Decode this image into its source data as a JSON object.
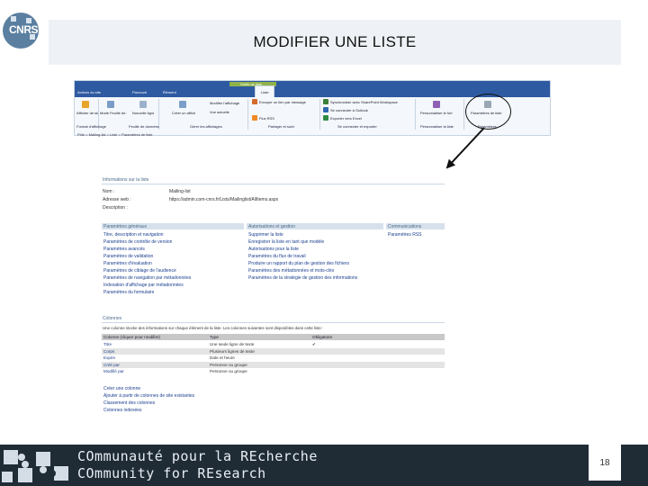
{
  "logo": {
    "text": "CNRS"
  },
  "slide": {
    "title": "MODIFIER UNE LISTE",
    "number": "18"
  },
  "ribbon": {
    "context_tab": "Outils de liste",
    "tabs": [
      "Parcourir",
      "Élément",
      "Liste"
    ],
    "top_left": "Actions du site",
    "buttons": [
      "Afficher de standard",
      "Mode Feuille de données",
      "Nouvelle ligne",
      "Créer un affichage",
      "Modifier l'affichage",
      "Vue actuelle",
      "Envoyer un lien par message",
      "Flux RSS",
      "Synchroniser avec SharePoint Workspace",
      "Se connecter à Outlook",
      "Exporter vers Excel",
      "Personnaliser le formulaire",
      "Paramètres de liste"
    ],
    "groups": [
      "Format d'affichage",
      "Feuille de données",
      "Gérer les affichages",
      "Partager et suivi",
      "Se connecter et exporter",
      "Personnaliser la liste",
      "Paramètres"
    ],
    "breadcrumb": "Pôle > Mailing-list > Liste > Paramètres de liste"
  },
  "panel": {
    "section_title": "Informations sur la liste",
    "name_label": "Nom :",
    "name_value": "Mailing-list",
    "address_label": "Adresse web :",
    "address_value": "https://admin.com-cnrs.fr/Lists/Mailinglist/AllItems.aspx",
    "desc_label": "Description :",
    "col_general": "Paramètres généraux",
    "col_perms": "Autorisations et gestion",
    "col_comm": "Communications",
    "general_links": [
      "Titre, description et navigation",
      "Paramètres de contrôle de version",
      "Paramètres avancés",
      "Paramètres de validation",
      "Paramètres d'évaluation",
      "Paramètres de ciblage de l'audience",
      "Paramètres de navigation par métadonnées",
      "Indexation d'affichage par métadonnées",
      "Paramètres du formulaire"
    ],
    "perm_links": [
      "Supprimer la liste",
      "Enregistrer la liste en tant que modèle",
      "Autorisations pour la liste",
      "Paramètres du flux de travail",
      "Produire un rapport du plan de gestion des fichiers",
      "Paramètres des métadonnées et mots-clés",
      "Paramètres de la stratégie de gestion des informations"
    ],
    "comm_links": [
      "Paramètres RSS"
    ],
    "columns_title": "Colonnes",
    "columns_desc": "Une colonne stocke des informations sur chaque élément de la liste. Les colonnes suivantes sont disponibles dans cette liste :",
    "table_headers": [
      "Colonne (cliquer pour modifier)",
      "Type",
      "Obligatoire"
    ],
    "table_rows": [
      [
        "Titre",
        "Une seule ligne de texte",
        "✔"
      ],
      [
        "Corps",
        "Plusieurs lignes de texte",
        ""
      ],
      [
        "Expire",
        "Date et heure",
        ""
      ],
      [
        "Créé par",
        "Personne ou groupe",
        ""
      ],
      [
        "Modifié par",
        "Personne ou groupe",
        ""
      ]
    ],
    "column_links": [
      "Créer une colonne",
      "Ajouter à partir de colonnes de site existantes",
      "Classement des colonnes",
      "Colonnes indexées"
    ]
  },
  "footer": {
    "line1": "COmmunauté pour la REcherche",
    "line2": "COmmunity for REsearch"
  },
  "colors": {
    "ribbon_blue": "#2e5aa1",
    "footer_bg": "#1f2b35",
    "title_bg": "#eef2f6"
  }
}
